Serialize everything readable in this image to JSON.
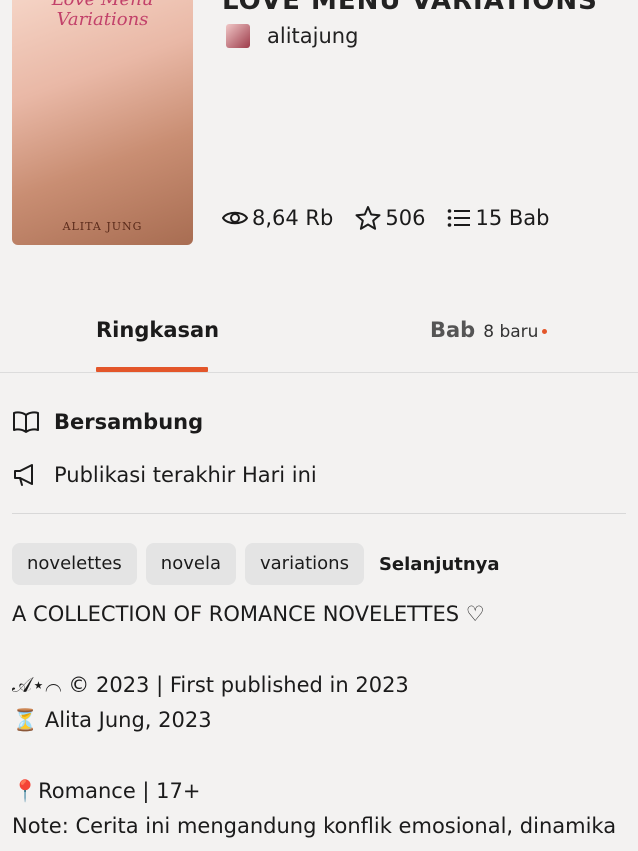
{
  "book": {
    "title": "LOVE MENU VARIATIONS",
    "cover_title": "Love Menu Variations",
    "cover_author": "ALITA JUNG",
    "author": "alitajung"
  },
  "stats": {
    "reads": "8,64 Rb",
    "votes": "506",
    "parts": "15 Bab"
  },
  "tabs": {
    "summary": "Ringkasan",
    "chapters": "Bab",
    "chapters_new": "8 baru"
  },
  "info": {
    "status": "Bersambung",
    "published": "Publikasi terakhir Hari ini"
  },
  "tags": [
    "novelettes",
    "novela",
    "variations"
  ],
  "tags_more": "Selanjutnya",
  "description": [
    "A COLLECTION OF ROMANCE NOVELETTES ♡",
    "",
    "𝒜⋆⌒ © 2023 | First published in 2023",
    "⏳ Alita Jung, 2023",
    "",
    "📍Romance | 17+",
    "Note: Cerita ini mengandung konflik emosional, dinamika"
  ],
  "colors": {
    "accent": "#e3562a",
    "tag_bg": "#e4e4e4",
    "page_bg": "#f3f2f1"
  }
}
